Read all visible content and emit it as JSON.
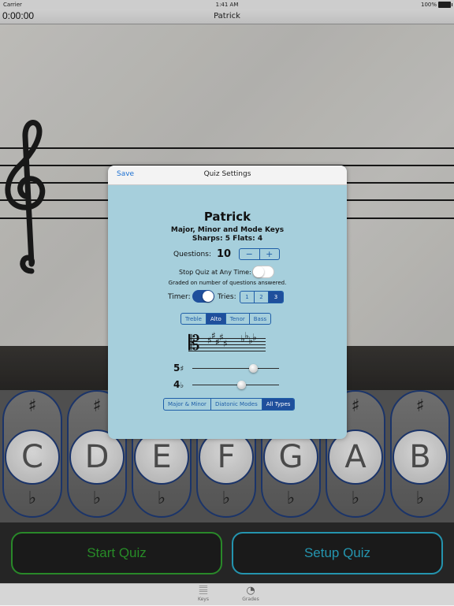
{
  "status_bar": {
    "carrier": "Carrier",
    "time": "1:41 AM",
    "battery": "100%"
  },
  "nav_bar": {
    "elapsed": "0:00:00",
    "title": "Patrick"
  },
  "staff": {
    "clef": "𝄞"
  },
  "keys": [
    {
      "note": "C",
      "sharp": "♯",
      "flat": "♭"
    },
    {
      "note": "D",
      "sharp": "♯",
      "flat": "♭"
    },
    {
      "note": "E",
      "sharp": "♯",
      "flat": "♭"
    },
    {
      "note": "F",
      "sharp": "♯",
      "flat": "♭"
    },
    {
      "note": "G",
      "sharp": "♯",
      "flat": "♭"
    },
    {
      "note": "A",
      "sharp": "♯",
      "flat": "♭"
    },
    {
      "note": "B",
      "sharp": "♯",
      "flat": "♭"
    }
  ],
  "buttons": {
    "start_quiz": "Start Quiz",
    "setup_quiz": "Setup Quiz"
  },
  "tab_bar": {
    "tabs": [
      {
        "label": "Keys",
        "icon": "keys-icon",
        "glyph": "𝄚"
      },
      {
        "label": "Grades",
        "icon": "grades-icon",
        "glyph": "◔"
      }
    ]
  },
  "modal": {
    "save": "Save",
    "title": "Quiz Settings",
    "quiz_name": "Patrick",
    "quiz_type": "Major, Minor and Mode Keys",
    "signature": "Sharps: 5  Flats: 4",
    "questions_label": "Questions:",
    "questions_value": "10",
    "stepper": {
      "minus": "−",
      "plus": "+"
    },
    "stop_label": "Stop Quiz at Any Time:",
    "stop_enabled": false,
    "graded_note": "Graded on number of questions answered.",
    "timer_label": "Timer:",
    "timer_enabled": true,
    "tries_label": "Tries:",
    "tries_options": [
      "1",
      "2",
      "3"
    ],
    "tries_selected": "3",
    "clef_options": [
      "Treble",
      "Alto",
      "Tenor",
      "Bass"
    ],
    "clef_selected": "Alto",
    "key_signature": {
      "clef_glyph": "𝄡",
      "sharp": "♯",
      "flat": "♭"
    },
    "sharps_slider": {
      "count": "5",
      "symbol": "♯",
      "fraction": 0.7
    },
    "flats_slider": {
      "count": "4",
      "symbol": "♭",
      "fraction": 0.57
    },
    "type_options": [
      "Major & Minor",
      "Diatonic Modes",
      "All Types"
    ],
    "type_selected": "All Types"
  },
  "colors": {
    "modal_bg": "#a6cfdc",
    "accent_blue": "#1f4f9c",
    "start_green": "#2d9f2d",
    "setup_cyan": "#2aa9c7"
  }
}
